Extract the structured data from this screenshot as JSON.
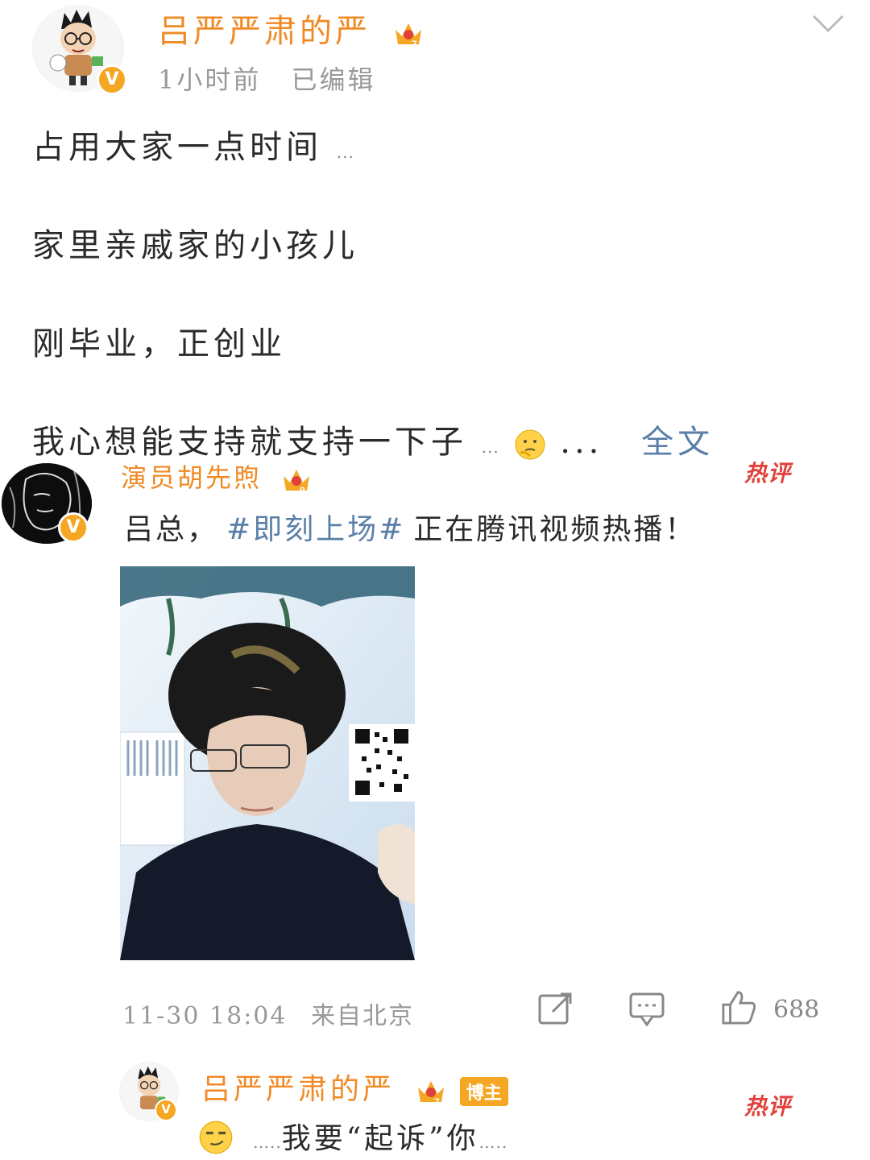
{
  "post": {
    "author": "吕严严肃的严",
    "time": "1小时前",
    "edited": "已编辑",
    "lines": [
      "占用大家一点时间",
      "家里亲戚家的小孩儿",
      "刚毕业，正创业",
      "我心想能支持就支持一下子"
    ],
    "ellipsis": "...",
    "trailing_dots": "...",
    "full_text_link": "全文"
  },
  "hot_comment_1": {
    "author": "演员胡先煦",
    "hot_badge": "热评",
    "text_prefix": "吕总，",
    "topic": "#即刻上场#",
    "text_suffix": "正在腾讯视频热播！",
    "date": "11-30 18:04",
    "location": "来自北京",
    "like_count": "688"
  },
  "hot_comment_2": {
    "author": "吕严严肃的严",
    "blogger_tag": "博主",
    "hot_badge": "热评",
    "text": "…..我要“起诉”你…..",
    "text_lead": "…..",
    "text_main": "我要“起诉”你",
    "text_tail": "…..",
    "emoji": "smirk-face"
  },
  "colors": {
    "username": "#f08a24",
    "link": "#5a7fa8",
    "hot": "#e0413a",
    "badge": "#f5a623"
  }
}
